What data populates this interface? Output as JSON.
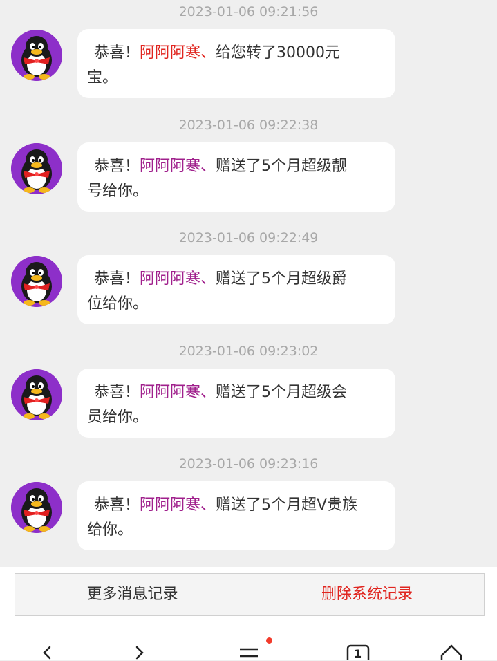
{
  "messages": [
    {
      "timestamp": "2023-01-06 09:21:56",
      "prefix": "恭喜！",
      "name": "阿阿阿寒",
      "name_color": "red",
      "sep": "、",
      "line1_rest": "给您转了30000元",
      "line2": "宝。"
    },
    {
      "timestamp": "2023-01-06 09:22:38",
      "prefix": "恭喜！",
      "name": "阿阿阿寒",
      "name_color": "purple",
      "sep": "、",
      "line1_rest": "赠送了5个月超级靓",
      "line2": "号给你。"
    },
    {
      "timestamp": "2023-01-06 09:22:49",
      "prefix": "恭喜！",
      "name": "阿阿阿寒",
      "name_color": "purple",
      "sep": "、",
      "line1_rest": "赠送了5个月超级爵",
      "line2": "位给你。"
    },
    {
      "timestamp": "2023-01-06 09:23:02",
      "prefix": "恭喜！",
      "name": "阿阿阿寒",
      "name_color": "purple",
      "sep": "、",
      "line1_rest": "赠送了5个月超级会",
      "line2": "员给你。"
    },
    {
      "timestamp": "2023-01-06 09:23:16",
      "prefix": "恭喜！",
      "name": "阿阿阿寒",
      "name_color": "purple",
      "sep": "、",
      "line1_rest": "赠送了5个月超V贵族",
      "line2": "给你。"
    }
  ],
  "footer": {
    "more_label": "更多消息记录",
    "delete_label": "删除系统记录"
  },
  "nav": {
    "tab_count": "1",
    "menu_has_notification": true
  },
  "colors": {
    "name_red": "#e0251f",
    "name_purple": "#a0208c",
    "delete_red": "#e0251f",
    "avatar_purple": "#8d2fc9",
    "badge_red": "#f23b2b"
  }
}
